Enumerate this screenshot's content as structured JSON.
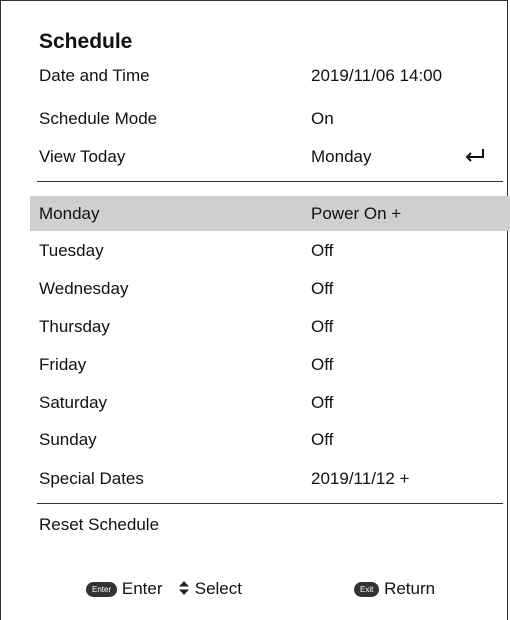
{
  "title": "Schedule",
  "header_rows": [
    {
      "label": "Date and Time",
      "value": "2019/11/06 14:00"
    },
    {
      "label": "Schedule Mode",
      "value": "On"
    },
    {
      "label": "View Today",
      "value": "Monday",
      "icon": "return-arrow-icon"
    }
  ],
  "days": [
    {
      "label": "Monday",
      "value": "Power On +",
      "selected": true
    },
    {
      "label": "Tuesday",
      "value": "Off"
    },
    {
      "label": "Wednesday",
      "value": "Off"
    },
    {
      "label": "Thursday",
      "value": "Off"
    },
    {
      "label": "Friday",
      "value": "Off"
    },
    {
      "label": "Saturday",
      "value": "Off"
    },
    {
      "label": "Sunday",
      "value": "Off"
    },
    {
      "label": "Special Dates",
      "value": "2019/11/12 +"
    }
  ],
  "reset_label": "Reset Schedule",
  "footer": {
    "enter_key": "Enter",
    "enter_label": "Enter",
    "select_icon": "up-down-arrows-icon",
    "select_label": "Select",
    "exit_key": "Exit",
    "return_label": "Return"
  },
  "colors": {
    "highlight": "#cfcfcf",
    "border": "#333333",
    "text": "#111111"
  }
}
